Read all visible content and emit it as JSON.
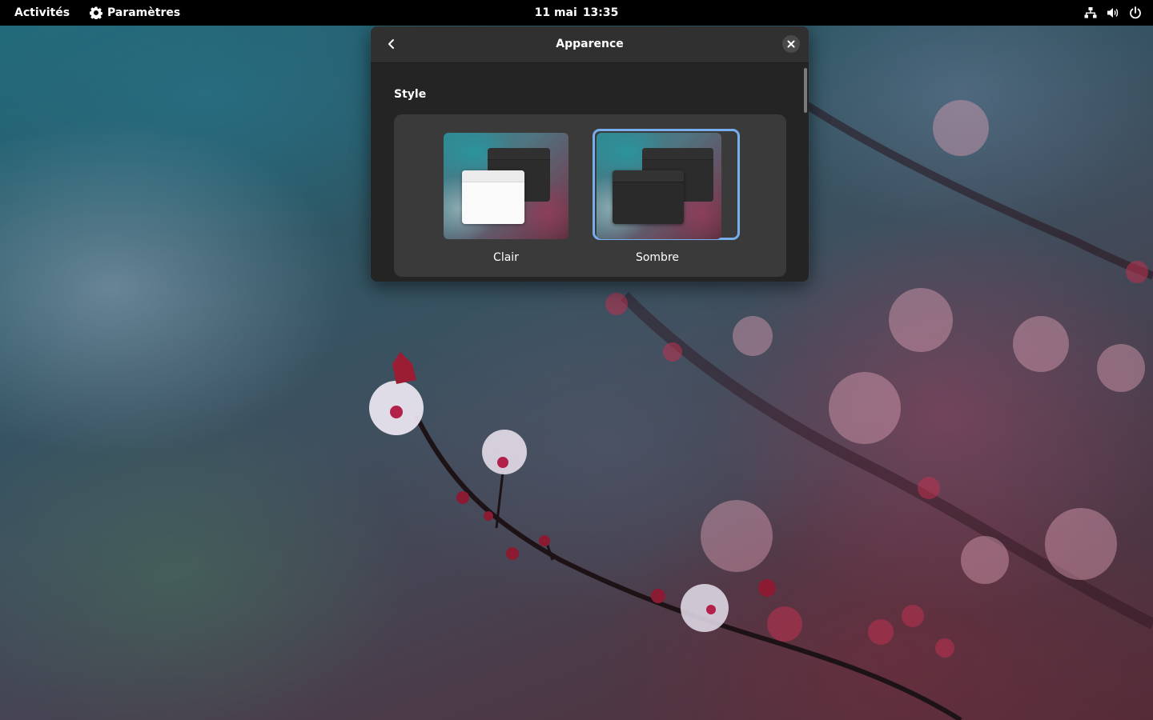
{
  "topbar": {
    "activities_label": "Activités",
    "app_menu_label": "Paramètres",
    "date": "11 mai",
    "time": "13:35",
    "tray_icons": [
      "network-icon",
      "volume-icon",
      "power-icon"
    ]
  },
  "window": {
    "title": "Apparence",
    "back_icon": "chevron-left-icon",
    "close_icon": "close-icon",
    "section_title": "Style",
    "style_options": [
      {
        "label": "Clair",
        "selected": false
      },
      {
        "label": "Sombre",
        "selected": true
      }
    ]
  },
  "colors": {
    "accent": "#78aeed",
    "window_bg": "#242424",
    "headerbar_bg": "#303030",
    "card_bg": "#3a3a3a",
    "topbar_bg": "#000000"
  }
}
